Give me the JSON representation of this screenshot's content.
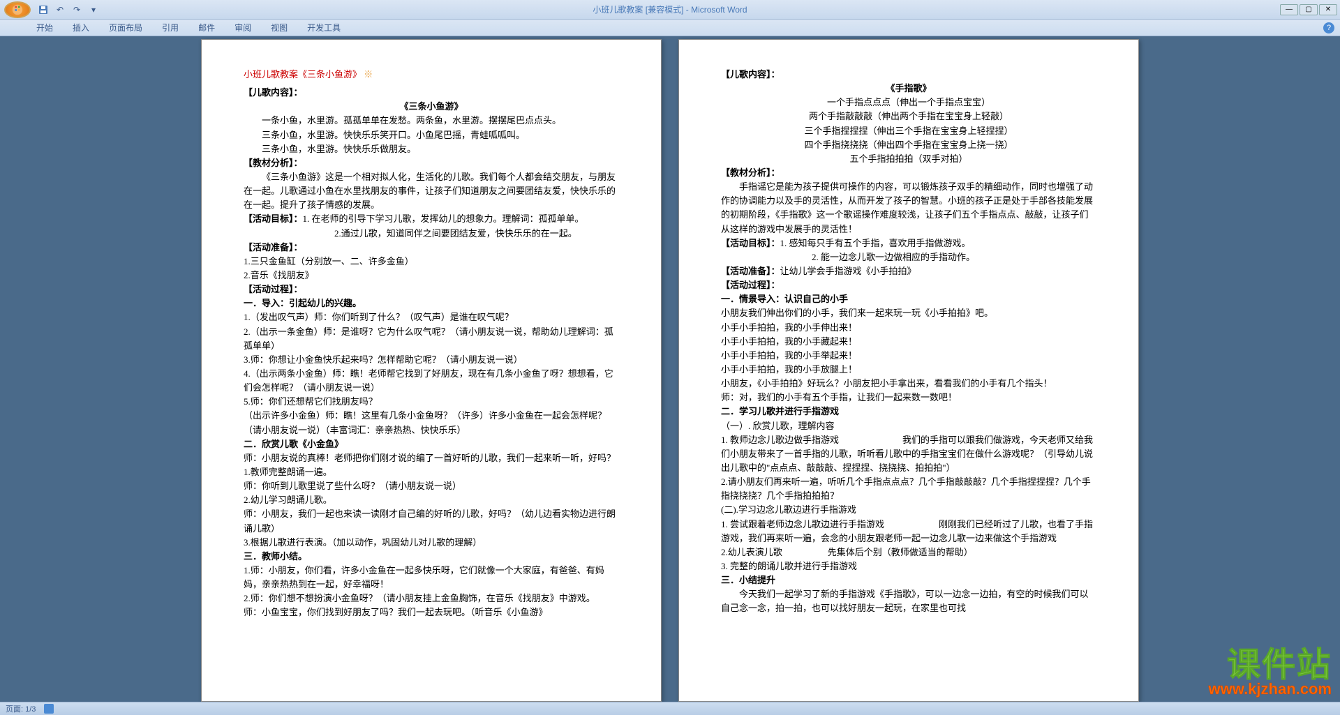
{
  "window": {
    "title": "小班儿歌教案 [兼容模式] - Microsoft Word"
  },
  "ribbon": {
    "tabs": [
      "开始",
      "插入",
      "页面布局",
      "引用",
      "邮件",
      "审阅",
      "视图",
      "开发工具"
    ]
  },
  "statusbar": {
    "page_info": "页面: 1/3"
  },
  "watermark": {
    "line1": "课件站",
    "line2": "www.kjzhan.com"
  },
  "page1": {
    "doc_title": "小班儿歌教案《三条小鱼游》",
    "s1_header": "【儿歌内容】：",
    "s1_title": "《三条小鱼游》",
    "s1_l1": "一条小鱼，水里游。孤孤单单在发愁。两条鱼，水里游。摆摆尾巴点点头。",
    "s1_l2": "三条小鱼，水里游。快快乐乐笑开口。小鱼尾巴摇，青蛙呱呱叫。",
    "s1_l3": "三条小鱼，水里游。快快乐乐做朋友。",
    "s2_header": "【教材分析】：",
    "s2_l1": "《三条小鱼游》这是一个相对拟人化，生活化的儿歌。我们每个人都会结交朋友，与朋友在一起。儿歌通过小鱼在水里找朋友的事件，让孩子们知道朋友之间要团结友爱，快快乐乐的在一起。提升了孩子情感的发展。",
    "s3_header": "【活动目标】：",
    "s3_l1": "1. 在老师的引导下学习儿歌，发挥幼儿的想象力。理解词：孤孤单单。",
    "s3_l2": "2.通过儿歌，知道同伴之间要团结友爱，快快乐乐的在一起。",
    "s4_header": "【活动准备】：",
    "s4_l1": "1.三只金鱼缸（分别放一、二、许多金鱼）",
    "s4_l2": "2.音乐《找朋友》",
    "s5_header": "【活动过程】：",
    "s5_t1": "一．导入：引起幼儿的兴趣。",
    "s5_l1": "1.（发出叹气声）师：你们听到了什么？（叹气声）是谁在叹气呢？",
    "s5_l2": "2.（出示一条金鱼）师：是谁呀？它为什么叹气呢？（请小朋友说一说，帮助幼儿理解词：孤孤单单）",
    "s5_l3": "3.师：你想让小金鱼快乐起来吗？怎样帮助它呢？（请小朋友说一说）",
    "s5_l4": "4.（出示两条小金鱼）师：瞧！老师帮它找到了好朋友，现在有几条小金鱼了呀？想想看，它们会怎样呢？（请小朋友说一说）",
    "s5_l5": "5.师：你们还想帮它们找朋友吗？",
    "s5_l6": "（出示许多小金鱼）师：瞧！这里有几条小金鱼呀？（许多）许多小金鱼在一起会怎样呢？（请小朋友说一说）（丰富词汇：亲亲热热、快快乐乐）",
    "s5_t2": "二．欣赏儿歌《小金鱼》",
    "s5_l7": "师：小朋友说的真棒！老师把你们刚才说的编了一首好听的儿歌，我们一起来听一听，好吗？",
    "s5_l8": "1.教师完整朗诵一遍。",
    "s5_l9": "师：你听到儿歌里说了些什么呀？（请小朋友说一说）",
    "s5_l10": "2.幼儿学习朗诵儿歌。",
    "s5_l11": "师：小朋友，我们一起也来读一读刚才自己编的好听的儿歌，好吗？（幼儿边看实物边进行朗诵儿歌）",
    "s5_l12": "3.根据儿歌进行表演。（加以动作，巩固幼儿对儿歌的理解）",
    "s5_t3": "三．教师小结。",
    "s5_l13": "1.师：小朋友，你们看，许多小金鱼在一起多快乐呀，它们就像一个大家庭，有爸爸、有妈妈，亲亲热热到在一起，好幸福呀！",
    "s5_l14": "2.师：你们想不想扮演小金鱼呀？（请小朋友挂上金鱼胸饰，在音乐《找朋友》中游戏。",
    "s5_l15": "师：小鱼宝宝，你们找到好朋友了吗？我们一起去玩吧。（听音乐《小鱼游》"
  },
  "page2": {
    "s1_header": "【儿歌内容】：",
    "s1_title": "《手指歌》",
    "s1_l1": "一个手指点点点（伸出一个手指点宝宝）",
    "s1_l2": "两个手指敲敲敲（伸出两个手指在宝宝身上轻敲）",
    "s1_l3": "三个手指捏捏捏（伸出三个手指在宝宝身上轻捏捏）",
    "s1_l4": "四个手指挠挠挠（伸出四个手指在宝宝身上挠一挠）",
    "s1_l5": "五个手指拍拍拍（双手对拍）",
    "s2_header": "【教材分析】：",
    "s2_l1": "手指谣它是能为孩子提供可操作的内容，可以锻炼孩子双手的精细动作，同时也增强了动作的协调能力以及手的灵活性，从而开发了孩子的智慧。小班的孩子正是处于手部各技能发展的初期阶段，《手指歌》这一个歌谣操作难度较浅，让孩子们五个手指点点、敲敲，让孩子们从这样的游戏中发展手的灵活性！",
    "s3_header": "【活动目标】：",
    "s3_l1": "1. 感知每只手有五个手指，喜欢用手指做游戏。",
    "s3_l2": "2. 能一边念儿歌一边做相应的手指动作。",
    "s4_header": "【活动准备】：",
    "s4_l1": "让幼儿学会手指游戏《小手拍拍》",
    "s5_header": "【活动过程】：",
    "s5_t1": "一．情景导入：认识自己的小手",
    "s5_l1": "小朋友我们伸出你们的小手，我们来一起来玩一玩《小手拍拍》吧。",
    "s5_l2": "小手小手拍拍，我的小手伸出来！",
    "s5_l3": "小手小手拍拍，我的小手藏起来！",
    "s5_l4": "小手小手拍拍，我的小手举起来！",
    "s5_l5": "小手小手拍拍，我的小手放腿上！",
    "s5_l6": "小朋友，《小手拍拍》好玩么？小朋友把小手拿出来，看看我们的小手有几个指头！",
    "s5_l7": "师：对，我们的小手有五个手指，让我们一起来数一数吧！",
    "s5_t2": "二．学习儿歌并进行手指游戏",
    "s5_l8": "（一）. 欣赏儿歌，理解内容",
    "s5_l9": "1. 教师边念儿歌边做手指游戏　　　　　　　我们的手指可以跟我们做游戏，今天老师又给我们小朋友带来了一首手指的儿歌，听听看儿歌中的手指宝宝们在做什么游戏呢？（引导幼儿说出儿歌中的\"点点点、敲敲敲、捏捏捏、挠挠挠、拍拍拍\"）",
    "s5_l10": "2.请小朋友们再来听一遍，听听几个手指点点点？几个手指敲敲敲？几个手指捏捏捏？几个手指挠挠挠？几个手指拍拍拍？",
    "s5_l11": "(二).学习边念儿歌边进行手指游戏",
    "s5_l12": "1. 尝试跟着老师边念儿歌边进行手指游戏　　　　　　刚刚我们已经听过了儿歌，也看了手指游戏，我们再来听一遍，会念的小朋友跟老师一起一边念儿歌一边来做这个手指游戏",
    "s5_l13": "2.幼儿表演儿歌　　　　　先集体后个别（教师做适当的帮助）",
    "s5_l14": "3. 完整的朗诵儿歌并进行手指游戏",
    "s5_t3": "三．小结提升",
    "s5_l15": "今天我们一起学习了新的手指游戏《手指歌》，可以一边念一边拍，有空的时候我们可以自己念一念，拍一拍，也可以找好朋友一起玩，在家里也可找"
  }
}
